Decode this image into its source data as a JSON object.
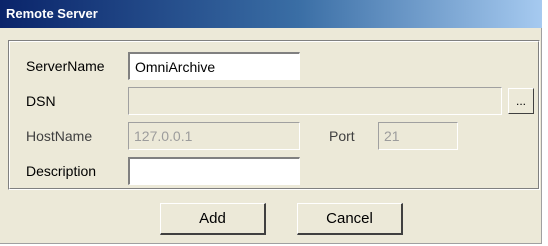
{
  "window": {
    "title": "Remote Server"
  },
  "form": {
    "server_name": {
      "label": "ServerName",
      "value": "OmniArchive"
    },
    "dsn": {
      "label": "DSN",
      "value": "",
      "browse_label": "..."
    },
    "host_name": {
      "label": "HostName",
      "value": "127.0.0.1"
    },
    "port": {
      "label": "Port",
      "value": "21"
    },
    "description": {
      "label": "Description",
      "value": ""
    }
  },
  "buttons": {
    "add_label": "Add",
    "cancel_label": "Cancel"
  },
  "colors": {
    "title_bar_start": "#0a246a",
    "title_bar_end": "#a6caf0",
    "dialog_background": "#ece9d8",
    "disabled_text": "#9c9c9c"
  }
}
